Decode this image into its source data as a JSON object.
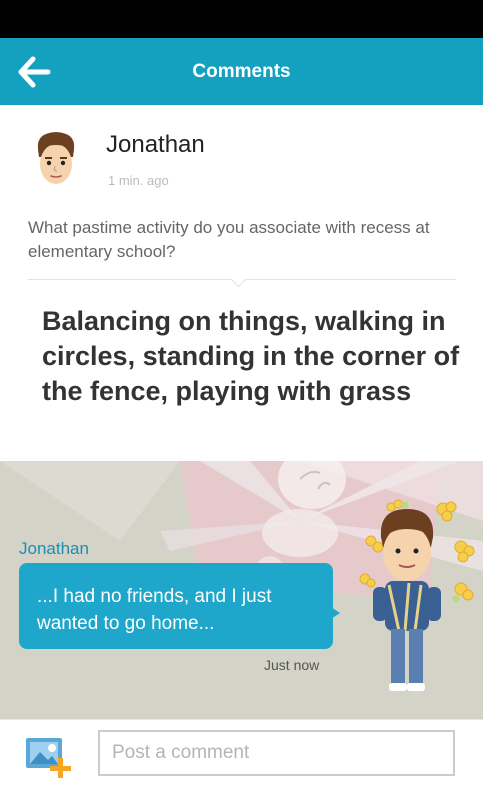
{
  "app": {
    "title": "Comments"
  },
  "post": {
    "author": "Jonathan",
    "time": "1 min. ago",
    "question": "What pastime activity do you associate with recess at elementary school?",
    "answer": "Balancing on things, walking in circles, standing in the corner of the fence, playing with grass"
  },
  "scene": {
    "speaker": "Jonathan",
    "message": "...I had no friends, and I just wanted to go home...",
    "timestamp": "Just now"
  },
  "composer": {
    "placeholder": "Post a comment"
  },
  "colors": {
    "accent": "#14a0bf",
    "bubble": "#1ea7cb",
    "name": "#1a8fb6"
  }
}
